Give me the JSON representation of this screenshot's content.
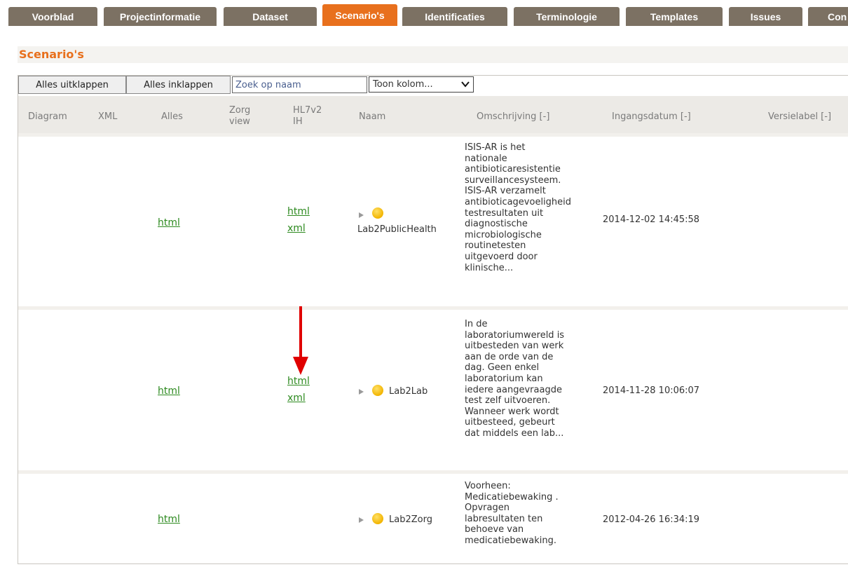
{
  "tabs": [
    {
      "label": "Voorblad",
      "active": false
    },
    {
      "label": "Projectinformatie",
      "active": false
    },
    {
      "label": "Dataset",
      "active": false
    },
    {
      "label": "Scenario's",
      "active": true
    },
    {
      "label": "Identificaties",
      "active": false
    },
    {
      "label": "Terminologie",
      "active": false
    },
    {
      "label": "Templates",
      "active": false
    },
    {
      "label": "Issues",
      "active": false
    },
    {
      "label": "Con",
      "active": false
    }
  ],
  "section": {
    "title": "Scenario's"
  },
  "toolbar": {
    "expand_all": "Alles uitklappen",
    "collapse_all": "Alles inklappen",
    "search_placeholder": "Zoek op naam",
    "column_select": "Toon kolom..."
  },
  "columns": {
    "diagram": "Diagram",
    "xml": "XML",
    "alles": "Alles",
    "zorg_view": [
      "Zorg",
      "view"
    ],
    "hl7v2_ih": [
      "HL7v2",
      "IH"
    ],
    "naam": "Naam",
    "omschrijving": "Omschrijving [-]",
    "ingangsdatum": "Ingangsdatum [-]",
    "versielabel": "Versielabel [-]"
  },
  "rows": [
    {
      "alles": "html",
      "hl7": [
        "html",
        "xml"
      ],
      "naam": "Lab2PublicHealth",
      "omschrijving": [
        "ISIS-AR is het",
        "nationale",
        "antibioticaresistentie",
        "surveillancesysteem.",
        "ISIS-AR verzamelt",
        "antibioticagevoeligheid",
        "testresultaten uit",
        "diagnostische",
        "microbiologische",
        "routinetesten",
        "uitgevoerd door",
        "klinische..."
      ],
      "ingangsdatum": "2014-12-02 14:45:58"
    },
    {
      "alles": "html",
      "hl7": [
        "html",
        "xml"
      ],
      "naam": "Lab2Lab",
      "omschrijving": [
        "In de",
        "laboratoriumwereld is",
        "uitbesteden van werk",
        "aan de orde van de",
        "dag. Geen enkel",
        "laboratorium kan",
        "iedere aangevraagde",
        "test zelf uitvoeren.",
        "Wanneer werk wordt",
        "uitbesteed, gebeurt",
        "dat middels een lab..."
      ],
      "ingangsdatum": "2014-11-28 10:06:07"
    },
    {
      "alles": "html",
      "hl7": [],
      "naam": "Lab2Zorg",
      "omschrijving": [
        "Voorheen:",
        "Medicatiebewaking .",
        "Opvragen",
        "labresultaten ten",
        "behoeve van",
        "medicatiebewaking."
      ],
      "ingangsdatum": "2012-04-26 16:34:19"
    }
  ],
  "colors": {
    "tab_bg": "#7c7163",
    "tab_active": "#e8701d",
    "link": "#2d8a1f",
    "annotation_arrow": "#e00000"
  }
}
